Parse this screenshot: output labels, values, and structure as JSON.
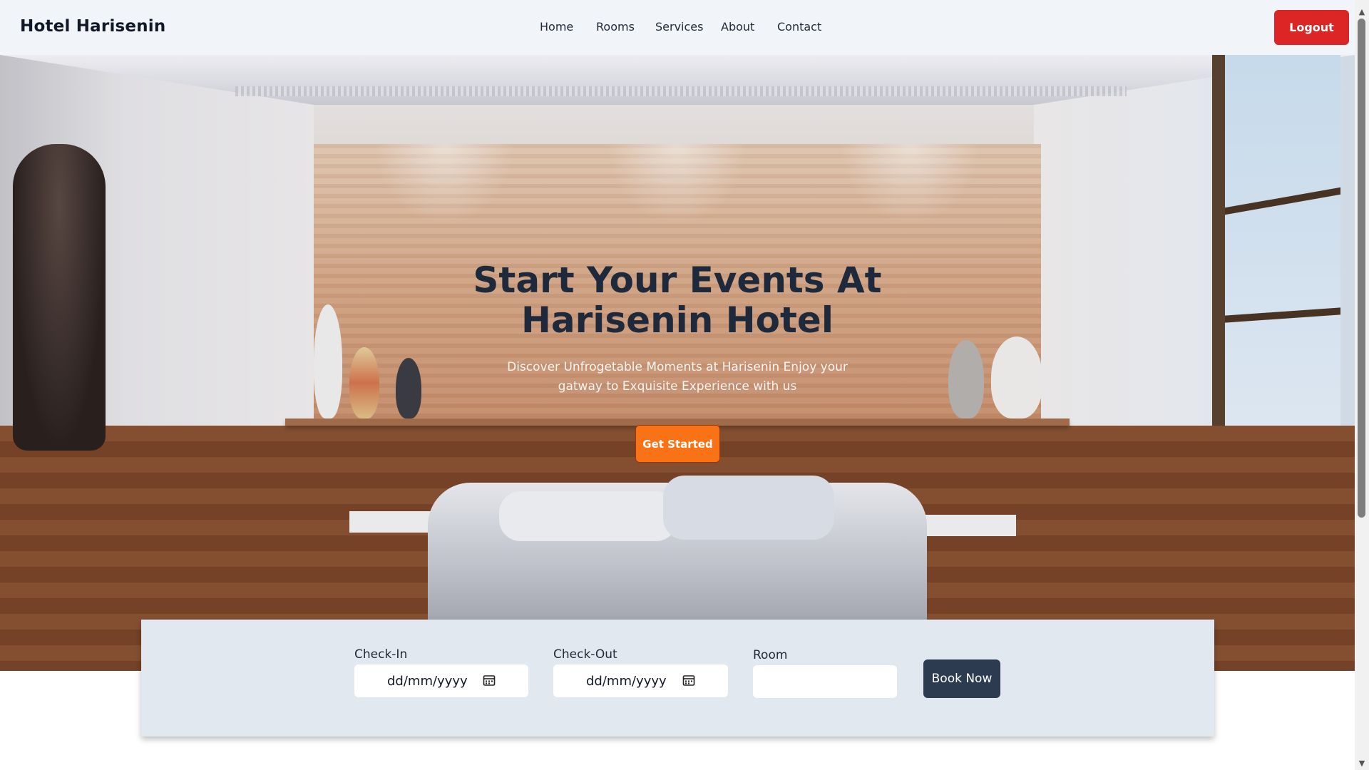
{
  "navbar": {
    "brand": "Hotel Harisenin",
    "links": [
      {
        "label": "Home"
      },
      {
        "label": "Rooms"
      },
      {
        "label": "Services"
      },
      {
        "label": "About"
      },
      {
        "label": "Contact"
      }
    ],
    "logout_label": "Logout"
  },
  "hero": {
    "title_line1": "Start Your Events At",
    "title_line2": "Harisenin Hotel",
    "subtitle_line1": "Discover Unfrogetable Moments at Harisenin Enjoy your",
    "subtitle_line2": "gatway to Exquisite Experience with us",
    "cta_label": "Get Started"
  },
  "booking": {
    "checkin_label": "Check-In",
    "checkin_value": "dd/mm/yyyy",
    "checkout_label": "Check-Out",
    "checkout_value": "dd/mm/yyyy",
    "room_label": "Room",
    "room_value": "",
    "book_label": "Book Now"
  },
  "colors": {
    "logout": "#dc2626",
    "cta": "#f97316",
    "book_button": "#2d3b50",
    "navbar_bg": "#f1f5f9",
    "booking_bg": "#e2e8f0"
  },
  "icons": [
    "calendar-icon",
    "scroll-up-arrow-icon",
    "scroll-down-arrow-icon"
  ]
}
